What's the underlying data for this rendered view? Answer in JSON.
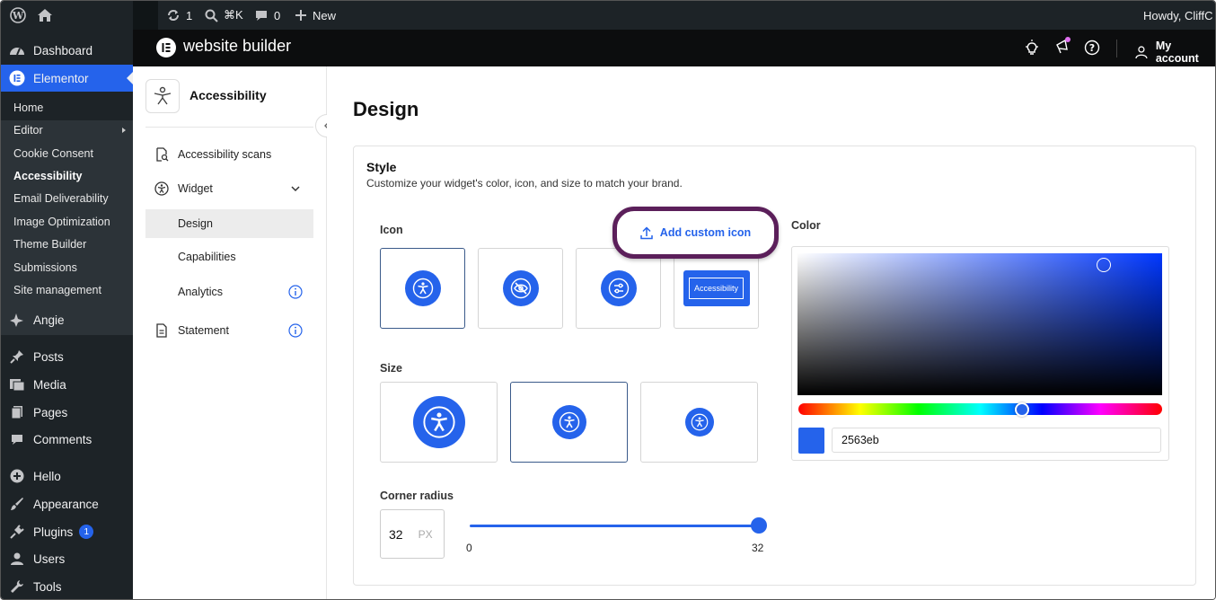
{
  "adminbar": {
    "updates_count": "1",
    "search_shortcut": "⌘K",
    "comments_count": "0",
    "new_label": "New",
    "howdy": "Howdy, CliffC"
  },
  "wpmenu": {
    "top_items": [
      {
        "label": "Dashboard",
        "icon": "dashboard-icon"
      },
      {
        "label": "Elementor",
        "icon": "elementor-icon"
      }
    ],
    "submenu": [
      {
        "label": "Home"
      },
      {
        "label": "Editor"
      },
      {
        "label": "Cookie Consent"
      },
      {
        "label": "Accessibility"
      },
      {
        "label": "Email Deliverability"
      },
      {
        "label": "Image Optimization"
      },
      {
        "label": "Theme Builder"
      },
      {
        "label": "Submissions"
      },
      {
        "label": "Site management"
      }
    ],
    "items": [
      {
        "label": "Angie",
        "icon": "angie-icon"
      },
      {
        "label": "Posts",
        "icon": "pin-icon"
      },
      {
        "label": "Media",
        "icon": "media-icon"
      },
      {
        "label": "Pages",
        "icon": "pages-icon"
      },
      {
        "label": "Comments",
        "icon": "comment-icon"
      },
      {
        "label": "Hello",
        "icon": "plus-circle-icon"
      },
      {
        "label": "Appearance",
        "icon": "brush-icon"
      },
      {
        "label": "Plugins",
        "icon": "plugin-icon",
        "badge": "1"
      },
      {
        "label": "Users",
        "icon": "user-icon"
      },
      {
        "label": "Tools",
        "icon": "wrench-icon"
      }
    ]
  },
  "header": {
    "brand": "website builder",
    "account": "My account"
  },
  "pluginnav": {
    "title": "Accessibility",
    "items": {
      "scans": "Accessibility scans",
      "widget": "Widget",
      "design": "Design",
      "capabilities": "Capabilities",
      "analytics": "Analytics",
      "statement": "Statement"
    }
  },
  "main": {
    "title": "Design",
    "style_title": "Style",
    "style_sub": "Customize your widget's color, icon, and size to match your brand.",
    "icon_label": "Icon",
    "add_custom_icon": "Add custom icon",
    "pill_text": "Accessibility",
    "size_label": "Size",
    "corner_label": "Corner radius",
    "corner_value": "32",
    "corner_unit": "PX",
    "slider_min": "0",
    "slider_max": "32",
    "slider_value": 32,
    "color_label": "Color",
    "hex_value": "2563eb",
    "accent": "#2563eb"
  }
}
